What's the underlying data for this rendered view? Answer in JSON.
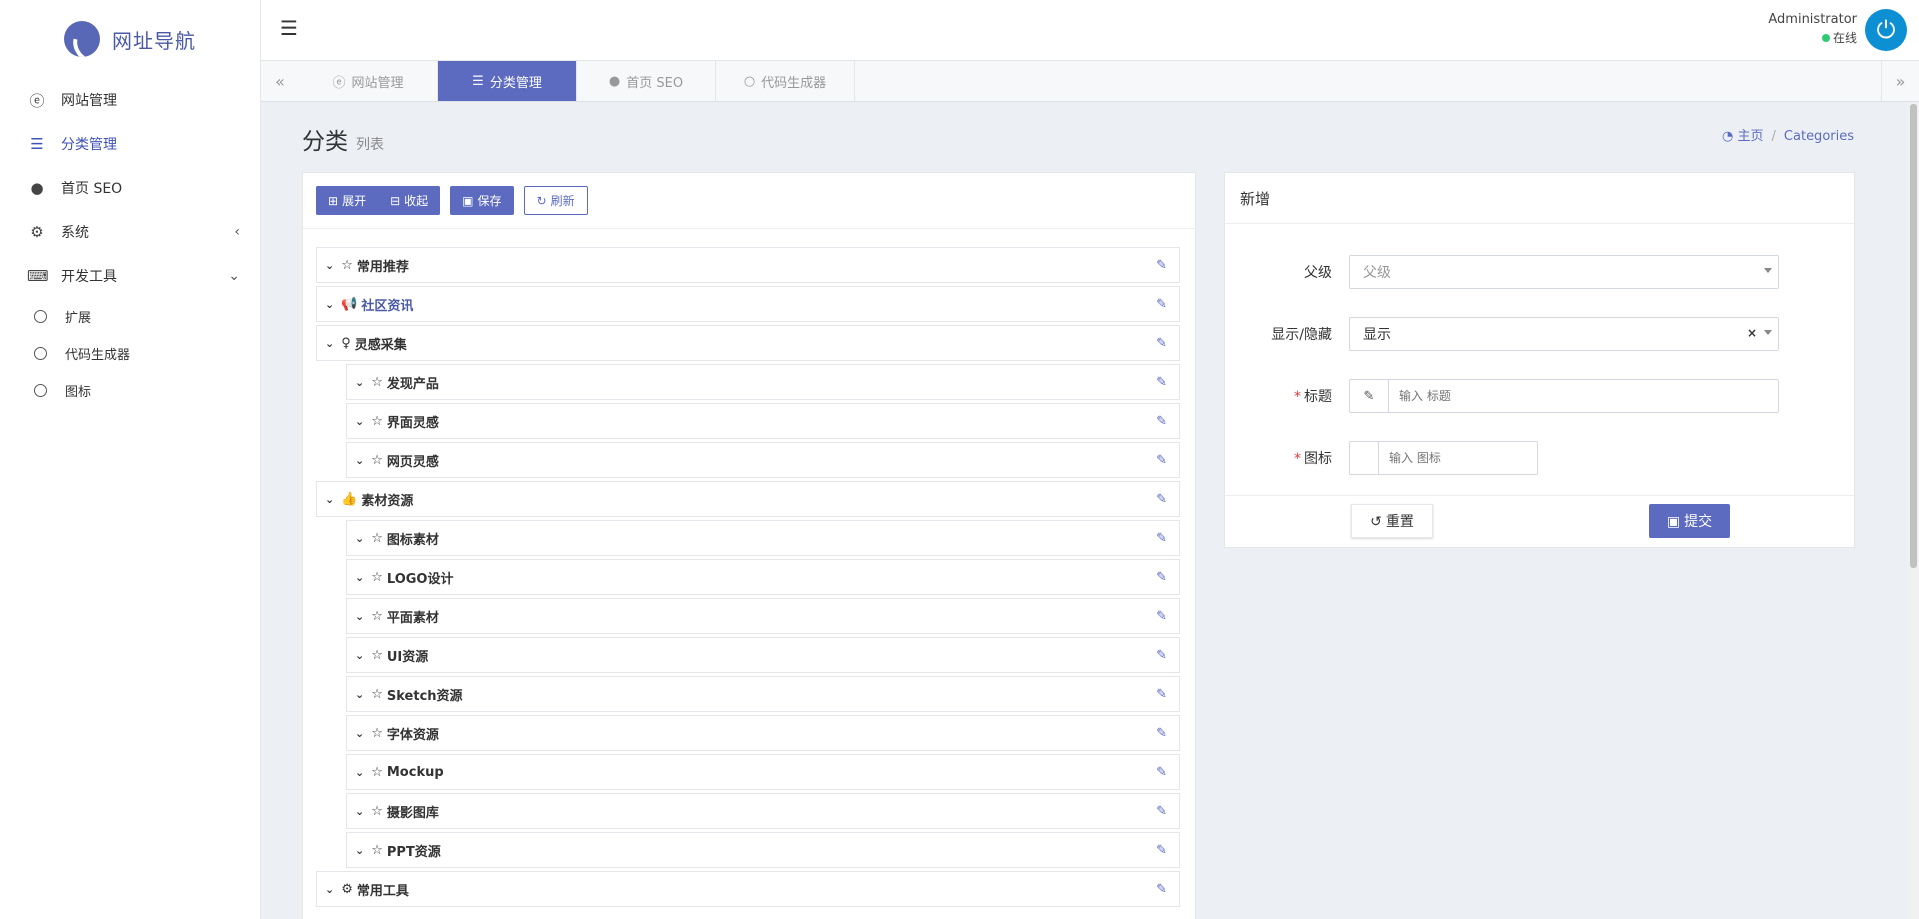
{
  "brand": {
    "name": "网址导航",
    "accent": "#5c6bc0"
  },
  "sidebar": {
    "items": [
      {
        "label": "网站管理",
        "icon": "ie-icon"
      },
      {
        "label": "分类管理",
        "icon": "list-icon",
        "active": true
      },
      {
        "label": "首页 SEO",
        "icon": "globe-icon"
      },
      {
        "label": "系统",
        "icon": "gear-icon"
      },
      {
        "label": "开发工具",
        "icon": "keyboard-icon"
      }
    ],
    "subitems": [
      {
        "label": "扩展"
      },
      {
        "label": "代码生成器"
      },
      {
        "label": "图标"
      }
    ]
  },
  "header": {
    "user_name": "Administrator",
    "user_status": "在线"
  },
  "tabs": [
    {
      "label": "网站管理"
    },
    {
      "label": "分类管理",
      "active": true
    },
    {
      "label": "首页 SEO"
    },
    {
      "label": "代码生成器"
    }
  ],
  "page": {
    "title": "分类",
    "subtitle": "列表",
    "breadcrumb_home": "主页",
    "breadcrumb_current": "Categories"
  },
  "toolbar": {
    "expand": "展开",
    "collapse": "收起",
    "save": "保存",
    "refresh": "刷新"
  },
  "tree": [
    {
      "label": "常用推荐",
      "icon": "star-icon"
    },
    {
      "label": "社区资讯",
      "icon": "bullhorn-icon"
    },
    {
      "label": "灵感采集",
      "icon": "lightbulb-icon"
    },
    {
      "label": "发现产品",
      "icon": "star-icon"
    },
    {
      "label": "界面灵感",
      "icon": "star-icon"
    },
    {
      "label": "网页灵感",
      "icon": "star-icon"
    },
    {
      "label": "素材资源",
      "icon": "thumbs-up-icon"
    },
    {
      "label": "图标素材",
      "icon": "star-icon"
    },
    {
      "label": "LOGO设计",
      "icon": "star-icon"
    },
    {
      "label": "平面素材",
      "icon": "star-icon"
    },
    {
      "label": "UI资源",
      "icon": "star-icon"
    },
    {
      "label": "Sketch资源",
      "icon": "star-icon"
    },
    {
      "label": "字体资源",
      "icon": "star-icon"
    },
    {
      "label": "Mockup",
      "icon": "star-icon"
    },
    {
      "label": "摄影图库",
      "icon": "star-icon"
    },
    {
      "label": "PPT资源",
      "icon": "star-icon"
    },
    {
      "label": "常用工具",
      "icon": "gears-icon"
    }
  ],
  "form": {
    "title": "新增",
    "parent_label": "父级",
    "parent_placeholder": "父级",
    "visibility_label": "显示/隐藏",
    "visibility_value": "显示",
    "title_label": "标题",
    "title_placeholder": "输入 标题",
    "icon_label": "图标",
    "icon_placeholder": "输入 图标",
    "reset": "重置",
    "submit": "提交"
  }
}
